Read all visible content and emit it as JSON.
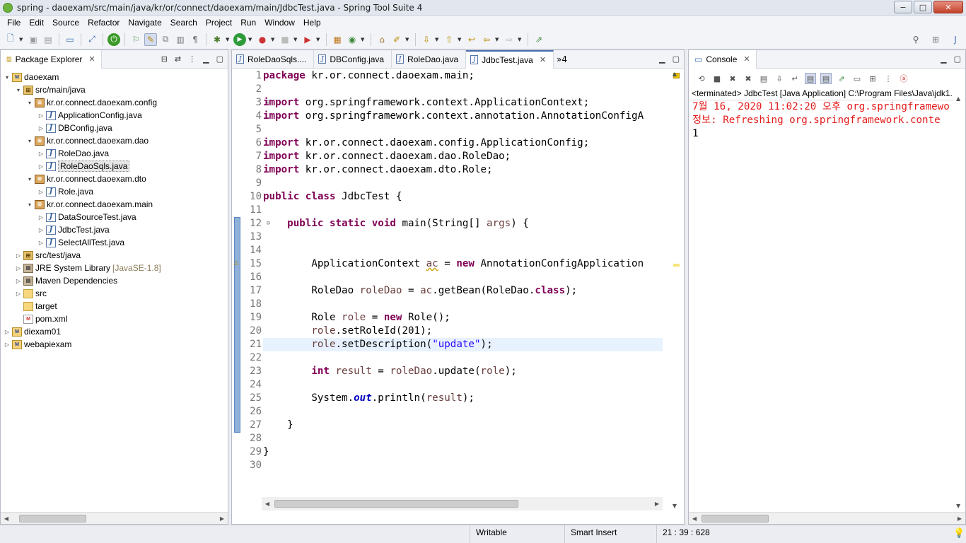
{
  "window": {
    "title": "spring - daoexam/src/main/java/kr/or/connect/daoexam/main/JdbcTest.java - Spring Tool Suite 4",
    "minimize": "−",
    "maximize": "□",
    "close": "✕"
  },
  "menu": [
    "File",
    "Edit",
    "Source",
    "Refactor",
    "Navigate",
    "Search",
    "Project",
    "Run",
    "Window",
    "Help"
  ],
  "package_explorer": {
    "tab_label": "Package Explorer",
    "tree": [
      {
        "label": "daoexam",
        "icon": "project-icon",
        "twisty": "▾"
      },
      {
        "label": "src/main/java",
        "icon": "source-folder-icon",
        "twisty": "▾"
      },
      {
        "label": "kr.or.connect.daoexam.config",
        "icon": "package-icon",
        "twisty": "▾"
      },
      {
        "label": "ApplicationConfig.java",
        "icon": "java-file-icon",
        "twisty": "▷"
      },
      {
        "label": "DBConfig.java",
        "icon": "java-file-icon",
        "twisty": "▷"
      },
      {
        "label": "kr.or.connect.daoexam.dao",
        "icon": "package-icon",
        "twisty": "▾"
      },
      {
        "label": "RoleDao.java",
        "icon": "java-file-icon",
        "twisty": "▷"
      },
      {
        "label": "RoleDaoSqls.java",
        "icon": "java-file-icon",
        "twisty": "▷",
        "selected": true
      },
      {
        "label": "kr.or.connect.daoexam.dto",
        "icon": "package-icon",
        "twisty": "▾"
      },
      {
        "label": "Role.java",
        "icon": "java-file-icon",
        "twisty": "▷"
      },
      {
        "label": "kr.or.connect.daoexam.main",
        "icon": "package-icon",
        "twisty": "▾"
      },
      {
        "label": "DataSourceTest.java",
        "icon": "java-file-icon",
        "twisty": "▷"
      },
      {
        "label": "JdbcTest.java",
        "icon": "java-file-icon",
        "twisty": "▷"
      },
      {
        "label": "SelectAllTest.java",
        "icon": "java-file-icon",
        "twisty": "▷"
      },
      {
        "label": "src/test/java",
        "icon": "source-folder-icon",
        "twisty": "▷"
      },
      {
        "label": "JRE System Library",
        "decoration": "[JavaSE-1.8]",
        "icon": "library-icon",
        "twisty": "▷"
      },
      {
        "label": "Maven Dependencies",
        "icon": "library-icon",
        "twisty": "▷"
      },
      {
        "label": "src",
        "icon": "folder-icon",
        "twisty": "▷"
      },
      {
        "label": "target",
        "icon": "folder-icon",
        "twisty": ""
      },
      {
        "label": "pom.xml",
        "icon": "xml-file-icon",
        "twisty": ""
      },
      {
        "label": "diexam01",
        "icon": "project-icon",
        "twisty": "▷"
      },
      {
        "label": "webapiexam",
        "icon": "project-icon",
        "twisty": "▷"
      }
    ]
  },
  "editor": {
    "tabs": [
      "RoleDaoSqls....",
      "DBConfig.java",
      "RoleDao.java",
      "JdbcTest.java"
    ],
    "overflow_count": "»4",
    "active_tab": 3,
    "line_numbers": [
      "1",
      "2",
      "3",
      "4",
      "5",
      "6",
      "7",
      "8",
      "9",
      "10",
      "11",
      "12",
      "13",
      "14",
      "15",
      "16",
      "17",
      "18",
      "19",
      "20",
      "21",
      "22",
      "23",
      "24",
      "25",
      "26",
      "27",
      "28",
      "29",
      "30"
    ],
    "highlighted_line": 21
  },
  "console": {
    "tab_label": "Console",
    "status": "<terminated> JdbcTest [Java Application] C:\\Program Files\\Java\\jdk1.",
    "lines": [
      "7월 16, 2020 11:02:20 오후 org.springframewo",
      "정보: Refreshing org.springframework.conte",
      "1"
    ]
  },
  "statusbar": {
    "mode": "Writable",
    "insert": "Smart Insert",
    "position": "21 : 39 : 628"
  },
  "colors": {
    "keyword": "#7f0055",
    "string": "#2a00ff",
    "console_error": "#e31b1b",
    "current_line": "#e8f2fe"
  }
}
